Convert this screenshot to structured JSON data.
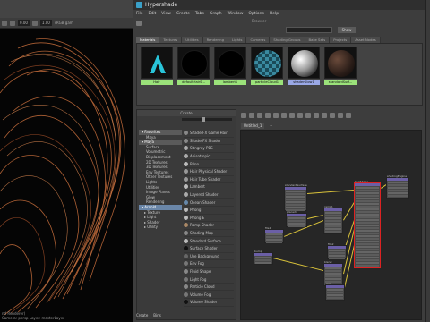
{
  "viewport": {
    "field_a": "0.00",
    "field_b": "1.00",
    "srgb_label": "sRGB gam",
    "status_lines": [
      "nd Renderer)",
      "Camera: persp  Layer: masterLayer"
    ]
  },
  "window": {
    "title": "Hypershade",
    "menu": [
      "File",
      "Edit",
      "View",
      "Create",
      "Tabs",
      "Graph",
      "Window",
      "Options",
      "Help"
    ]
  },
  "browser": {
    "title": "Browser",
    "search_placeholder": "",
    "show_label": "Show",
    "tabs": [
      "Materials",
      "Textures",
      "Utilities",
      "Rendering",
      "Lights",
      "Cameras",
      "Shading Groups",
      "Bake Sets",
      "Projects",
      "Asset Nodes"
    ],
    "active_tab": 0,
    "swatches": [
      {
        "label": "Hair",
        "style": "hair",
        "color": "#29c4d9",
        "label_bg": "#9be27a"
      },
      {
        "label": "defaultHairS...",
        "style": "black",
        "color": "#000000",
        "label_bg": "#9be27a"
      },
      {
        "label": "lambert1",
        "style": "black",
        "color": "#000000",
        "label_bg": "#9be27a"
      },
      {
        "label": "particleCloud1",
        "style": "checker",
        "color": "#3a8aa0",
        "label_bg": "#9be27a"
      },
      {
        "label": "shaderGlow1",
        "style": "sphere",
        "color": "#d0d0d0",
        "label_bg": "#9aa8e6"
      },
      {
        "label": "standardSurf...",
        "style": "dark",
        "color": "#2a1d18",
        "label_bg": "#9be27a"
      }
    ]
  },
  "create": {
    "title": "Create",
    "categories": [
      {
        "label": "Favorites",
        "kind": "head"
      },
      {
        "label": "Maya",
        "kind": "item"
      },
      {
        "label": "Maya",
        "kind": "head"
      },
      {
        "label": "Surface",
        "kind": "item"
      },
      {
        "label": "Volumetric",
        "kind": "item"
      },
      {
        "label": "Displacement",
        "kind": "item"
      },
      {
        "label": "2D Textures",
        "kind": "item"
      },
      {
        "label": "3D Textures",
        "kind": "item"
      },
      {
        "label": "Env Textures",
        "kind": "item"
      },
      {
        "label": "Other Textures",
        "kind": "item"
      },
      {
        "label": "Lights",
        "kind": "item"
      },
      {
        "label": "Utilities",
        "kind": "item"
      },
      {
        "label": "Image Planes",
        "kind": "item"
      },
      {
        "label": "Glow",
        "kind": "item"
      },
      {
        "label": "Rendering",
        "kind": "item"
      },
      {
        "label": "Arnold",
        "kind": "head-sel"
      },
      {
        "label": "Texture",
        "kind": "sub"
      },
      {
        "label": "Light",
        "kind": "sub"
      },
      {
        "label": "Shader",
        "kind": "sub"
      },
      {
        "label": "Utility",
        "kind": "sub"
      }
    ],
    "nodes": [
      {
        "label": "ShaderFX Game Hair",
        "color": "#888888"
      },
      {
        "label": "ShaderFX Shader",
        "color": "#888888"
      },
      {
        "label": "Stingray PBS",
        "color": "#aaaaaa"
      },
      {
        "label": "Anisotropic",
        "color": "#aaaaaa"
      },
      {
        "label": "Blinn",
        "color": "#bbbbbb"
      },
      {
        "label": "Hair Physical Shader",
        "color": "#999999"
      },
      {
        "label": "Hair Tube Shader",
        "color": "#999999"
      },
      {
        "label": "Lambert",
        "color": "#bbbbbb"
      },
      {
        "label": "Layered Shader",
        "color": "#aaaaaa"
      },
      {
        "label": "Ocean Shader",
        "color": "#6688aa"
      },
      {
        "label": "Phong",
        "color": "#bbbbbb"
      },
      {
        "label": "Phong E",
        "color": "#bbbbbb"
      },
      {
        "label": "Ramp Shader",
        "color": "#aa8866"
      },
      {
        "label": "Shading Map",
        "color": "#888888"
      },
      {
        "label": "Standard Surface",
        "color": "#bbbbbb"
      },
      {
        "label": "Surface Shader",
        "color": "#111111"
      },
      {
        "label": "Use Background",
        "color": "#666666"
      },
      {
        "label": "Env Fog",
        "color": "#777777"
      },
      {
        "label": "Fluid Shape",
        "color": "#888888"
      },
      {
        "label": "Light Fog",
        "color": "#777777"
      },
      {
        "label": "Particle Cloud",
        "color": "#888888"
      },
      {
        "label": "Volume Fog",
        "color": "#777777"
      },
      {
        "label": "Volume Shader",
        "color": "#111111"
      }
    ]
  },
  "node_editor": {
    "tab_label": "Untitled_1",
    "tab_close": "+",
    "nodes": [
      {
        "name": "standardSurface",
        "selected": false
      },
      {
        "name": "place2d",
        "selected": false
      },
      {
        "name": "ramp1",
        "selected": false
      },
      {
        "name": "file1",
        "selected": false
      },
      {
        "name": "file2",
        "selected": false
      },
      {
        "name": "blend",
        "selected": false
      },
      {
        "name": "bump",
        "selected": false
      },
      {
        "name": "mix",
        "selected": false
      },
      {
        "name": "hairShape",
        "selected": true
      },
      {
        "name": "shadingEngine",
        "selected": false
      }
    ]
  },
  "bottom": {
    "tabs": [
      "Create",
      "Bins"
    ]
  }
}
